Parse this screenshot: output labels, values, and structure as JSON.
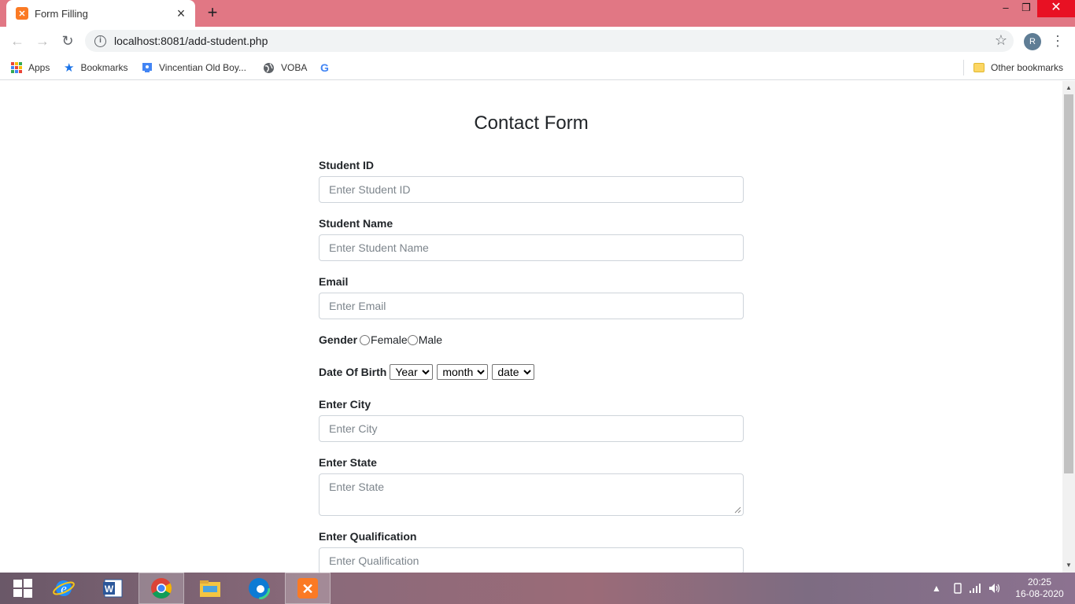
{
  "browser": {
    "tab": {
      "title": "Form Filling",
      "favicon": "xampp-icon"
    },
    "new_tab_label": "+",
    "url": "localhost:8081/add-student.php",
    "profile_initial": "R"
  },
  "bookmarks": {
    "items": [
      {
        "label": "Apps",
        "icon": "apps-grid-icon"
      },
      {
        "label": "Bookmarks",
        "icon": "star-icon"
      },
      {
        "label": "Vincentian Old Boy...",
        "icon": "classroom-icon"
      },
      {
        "label": "VOBA",
        "icon": "globe-icon"
      },
      {
        "label": "",
        "icon": "google-icon"
      }
    ],
    "other_label": "Other bookmarks"
  },
  "form": {
    "title": "Contact Form",
    "student_id": {
      "label": "Student ID",
      "placeholder": "Enter Student ID",
      "value": ""
    },
    "student_name": {
      "label": "Student Name",
      "placeholder": "Enter Student Name",
      "value": ""
    },
    "email": {
      "label": "Email",
      "placeholder": "Enter Email",
      "value": ""
    },
    "gender": {
      "label": "Gender",
      "options": [
        "Female",
        "Male"
      ]
    },
    "dob": {
      "label": "Date Of Birth",
      "year": "Year",
      "month": "month",
      "date": "date"
    },
    "city": {
      "label": "Enter City",
      "placeholder": "Enter City",
      "value": ""
    },
    "state": {
      "label": "Enter State",
      "placeholder": "Enter State",
      "value": ""
    },
    "qualification": {
      "label": "Enter Qualification",
      "placeholder": "Enter Qualification",
      "value": ""
    }
  },
  "taskbar": {
    "apps": [
      "windows-start-icon",
      "internet-explorer-icon",
      "word-icon",
      "chrome-icon",
      "file-explorer-icon",
      "edge-icon",
      "xampp-icon"
    ],
    "clock": {
      "time": "20:25",
      "date": "16-08-2020"
    }
  },
  "colors": {
    "titlebar": "#e17784",
    "accent_close": "#e81123",
    "taskbar": "#8a6a7a"
  }
}
